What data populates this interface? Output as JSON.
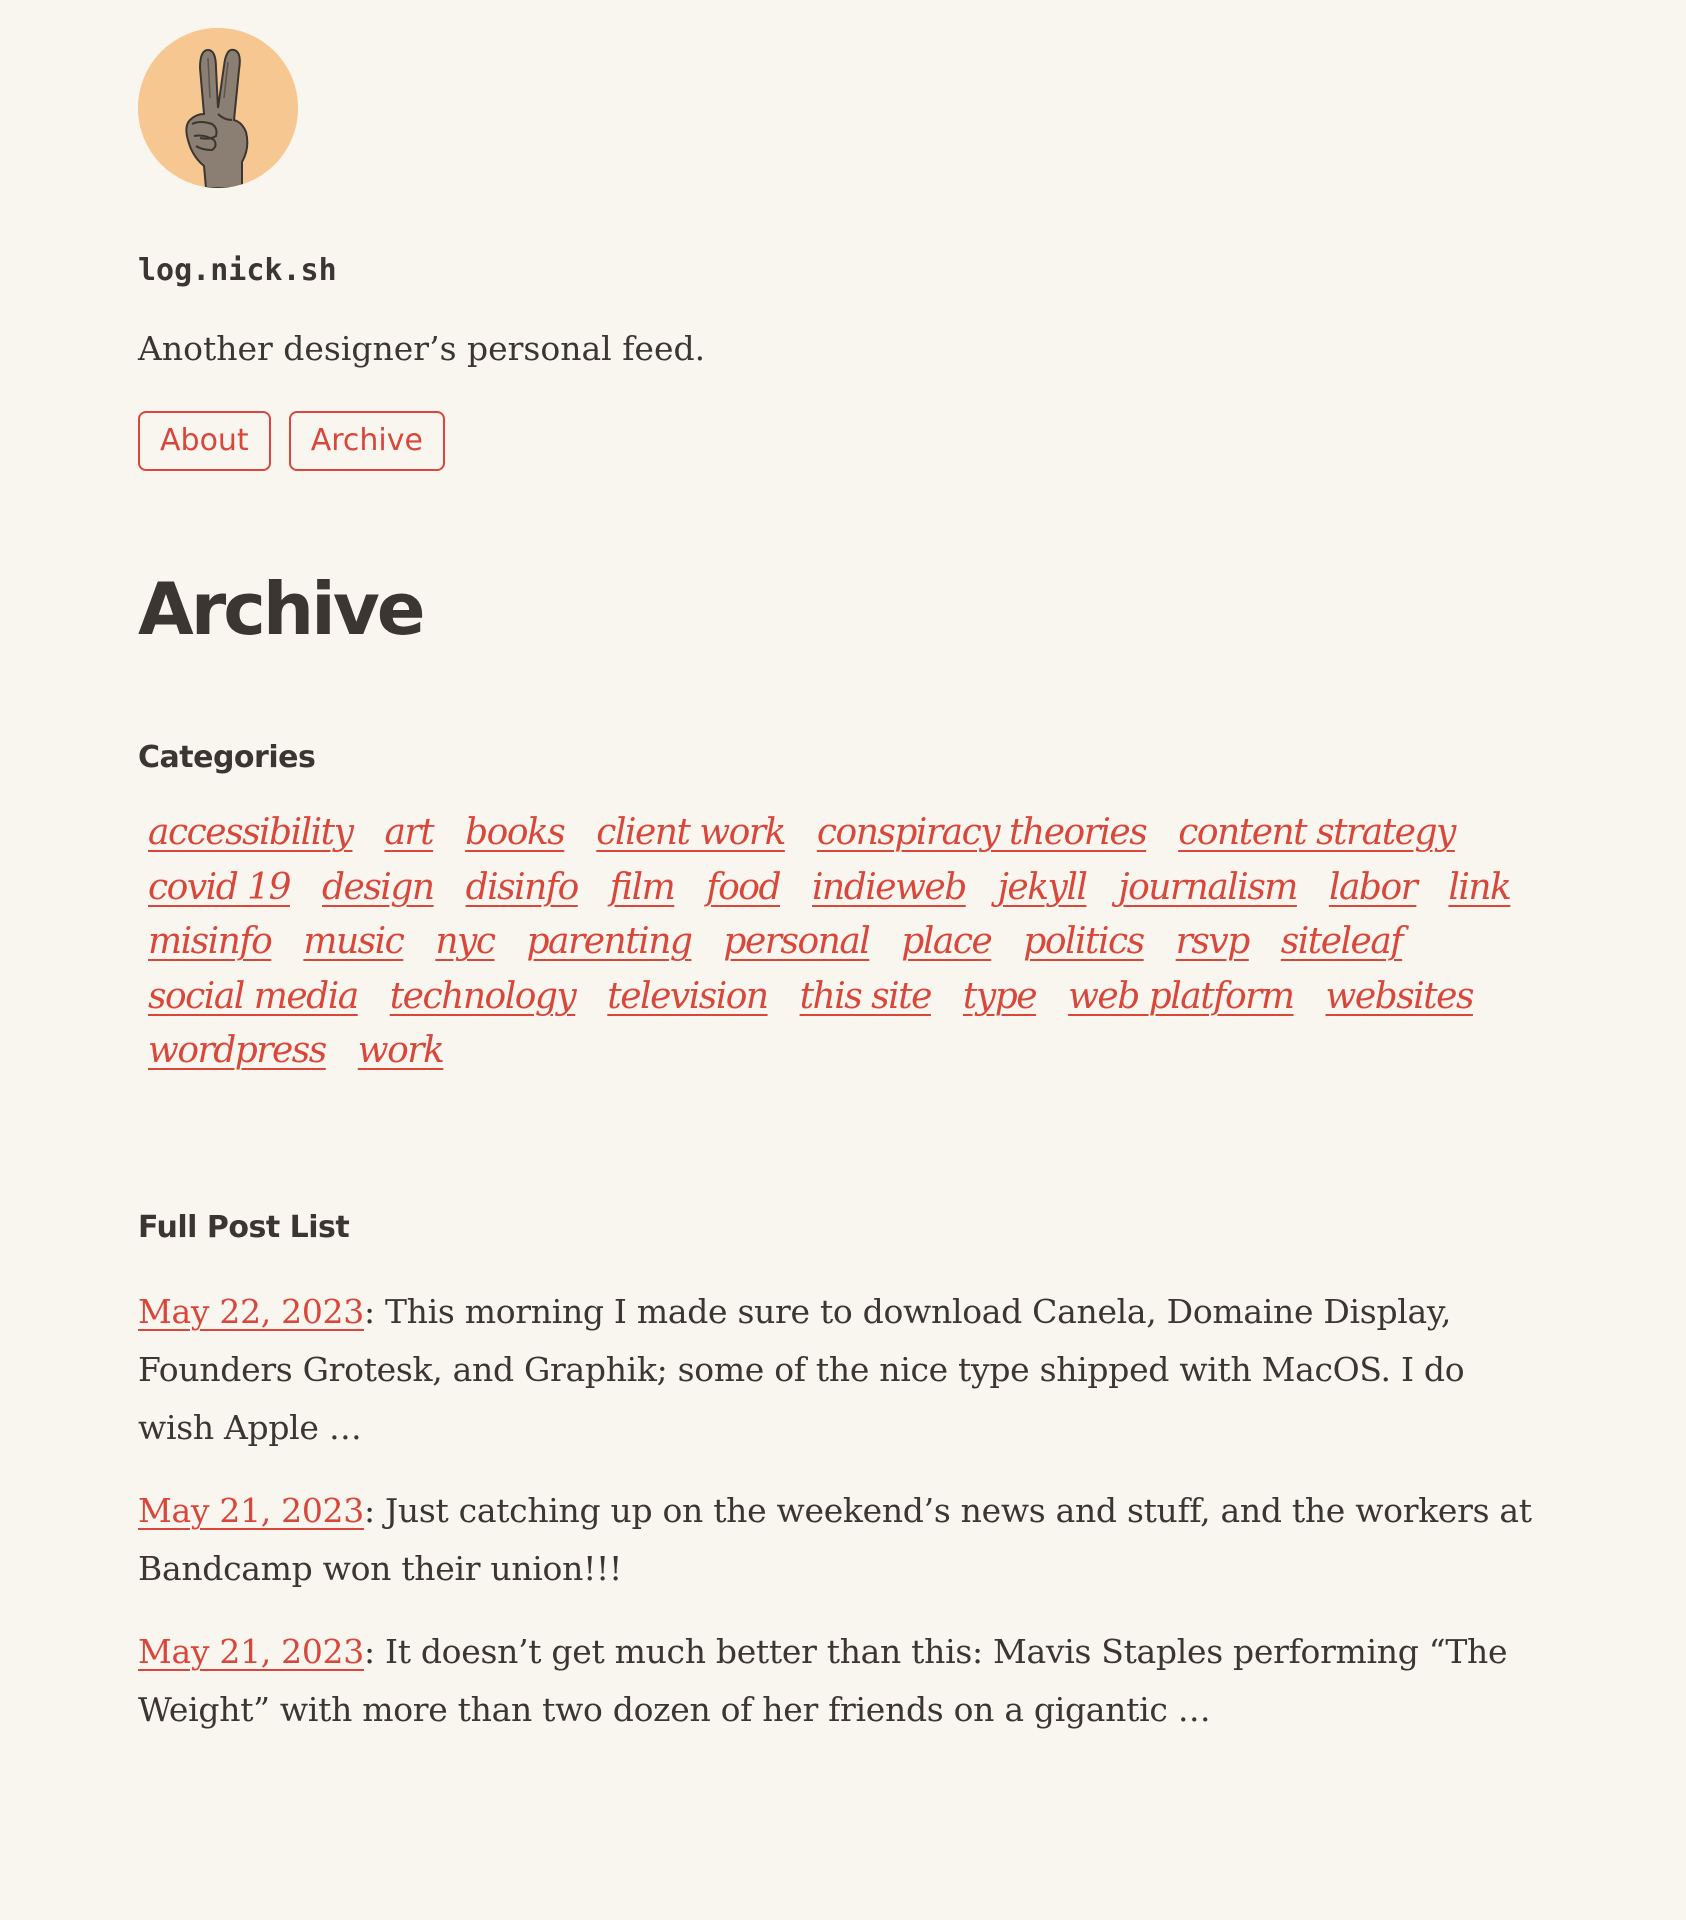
{
  "header": {
    "avatar_alt": "peace-hand-avatar",
    "site_title": "log.nick.sh",
    "tagline": "Another designer’s personal feed."
  },
  "nav": {
    "items": [
      {
        "label": "About"
      },
      {
        "label": "Archive"
      }
    ]
  },
  "main": {
    "title": "Archive",
    "categories_heading": "Categories",
    "categories": [
      "accessibility",
      "art",
      "books",
      "client work",
      "conspiracy theories",
      "content strategy",
      "covid 19",
      "design",
      "disinfo",
      "film",
      "food",
      "indieweb",
      "jekyll",
      "journalism",
      "labor",
      "link",
      "misinfo",
      "music",
      "nyc",
      "parenting",
      "personal",
      "place",
      "politics",
      "rsvp",
      "siteleaf",
      "social media",
      "technology",
      "television",
      "this site",
      "type",
      "web platform",
      "websites",
      "wordpress",
      "work"
    ],
    "posts_heading": "Full Post List",
    "posts": [
      {
        "date": "May 22, 2023",
        "separator": ": ",
        "text": "This morning I made sure to download Canela, Domaine Display, Founders Grotesk, and Graphik; some of the nice type shipped with MacOS. I do wish Apple …"
      },
      {
        "date": "May 21, 2023",
        "separator": ": ",
        "text": "Just catching up on the weekend’s news and stuff, and the workers at Bandcamp won their union!!!"
      },
      {
        "date": "May 21, 2023",
        "separator": ": ",
        "text": "It doesn’t get much better than this: Mavis Staples performing “The Weight” with more than two dozen of her friends on a gigantic …"
      }
    ]
  },
  "colors": {
    "background": "#f9f6f0",
    "text": "#3b3631",
    "accent": "#d9473b",
    "avatar_bg": "#f7c792"
  }
}
